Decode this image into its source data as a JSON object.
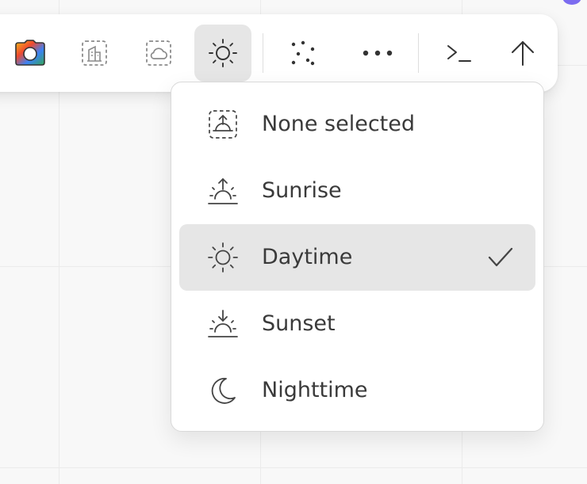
{
  "toolbar": {
    "buttons": [
      {
        "name": "camera-button",
        "icon": "camera-icon"
      },
      {
        "name": "building-frame-button",
        "icon": "building-frame-icon"
      },
      {
        "name": "cloud-frame-button",
        "icon": "cloud-frame-icon"
      },
      {
        "name": "time-of-day-button",
        "icon": "sun-icon",
        "active": true
      },
      {
        "name": "scatter-button",
        "icon": "scatter-dots-icon"
      },
      {
        "name": "more-button",
        "icon": "more-horizontal-icon"
      },
      {
        "name": "terminal-button",
        "icon": "terminal-icon"
      },
      {
        "name": "submit-button",
        "icon": "arrow-up-icon"
      }
    ]
  },
  "time_of_day_menu": {
    "items": [
      {
        "label": "None selected",
        "icon": "none-selected-icon",
        "selected": false
      },
      {
        "label": "Sunrise",
        "icon": "sunrise-icon",
        "selected": false
      },
      {
        "label": "Daytime",
        "icon": "sun-icon",
        "selected": true
      },
      {
        "label": "Sunset",
        "icon": "sunset-icon",
        "selected": false
      },
      {
        "label": "Nighttime",
        "icon": "moon-icon",
        "selected": false
      }
    ]
  },
  "colors": {
    "accent_dot": "#7c6cf0",
    "active_bg": "#e6e6e6",
    "text": "#3a3a3a"
  }
}
